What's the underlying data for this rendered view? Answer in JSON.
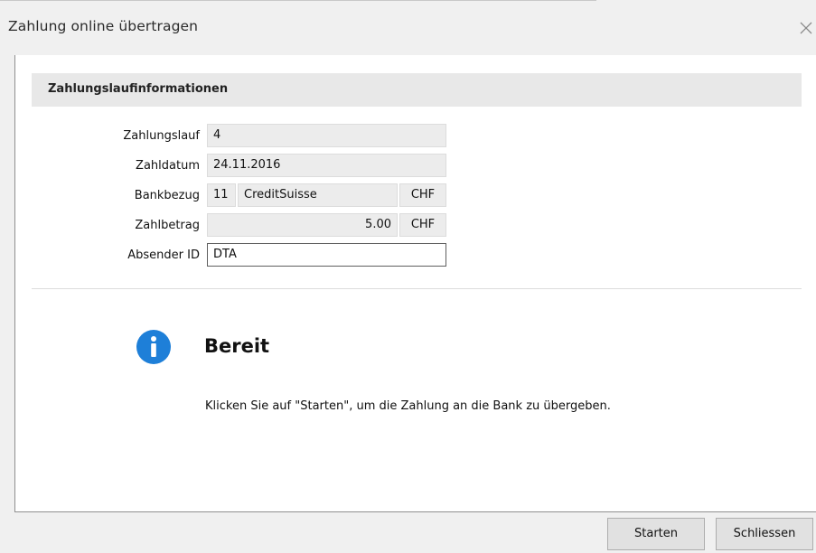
{
  "window": {
    "title": "Zahlung online übertragen"
  },
  "section": {
    "title": "Zahlungslaufinformationen"
  },
  "form": {
    "zahlungslauf": {
      "label": "Zahlungslauf",
      "value": "4"
    },
    "zahldatum": {
      "label": "Zahldatum",
      "value": "24.11.2016"
    },
    "bankbezug": {
      "label": "Bankbezug",
      "number": "11",
      "bank": "CreditSuisse",
      "currency": "CHF"
    },
    "zahlbetrag": {
      "label": "Zahlbetrag",
      "amount": "5.00",
      "currency": "CHF"
    },
    "absender_id": {
      "label": "Absender ID",
      "value": "DTA"
    }
  },
  "status": {
    "icon": "info-icon",
    "icon_color": "#1e7fd8",
    "title": "Bereit",
    "message": "Klicken Sie auf \"Starten\", um die Zahlung an die Bank zu übergeben."
  },
  "buttons": {
    "start": "Starten",
    "close": "Schliessen"
  }
}
